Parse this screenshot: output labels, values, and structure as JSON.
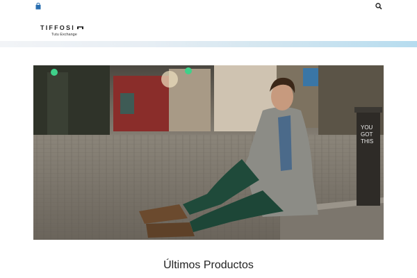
{
  "header": {
    "cart_icon": "shopping-bag-icon",
    "search_icon": "search-icon",
    "logo": {
      "brand": "TIFFOSI",
      "tagline": "Tutu Exchange"
    }
  },
  "hero": {
    "description": "Young man in grey cardigan and green jeans sitting on a cobblestone street curb holding a coffee cup",
    "sign_text": [
      "YOU",
      "GOT",
      "THIS"
    ]
  },
  "section": {
    "title": "Últimos Productos"
  },
  "colors": {
    "band_start": "#f2f4f7",
    "band_end": "#b6dcef",
    "icon": "#2a6fb0",
    "text": "#222222"
  }
}
